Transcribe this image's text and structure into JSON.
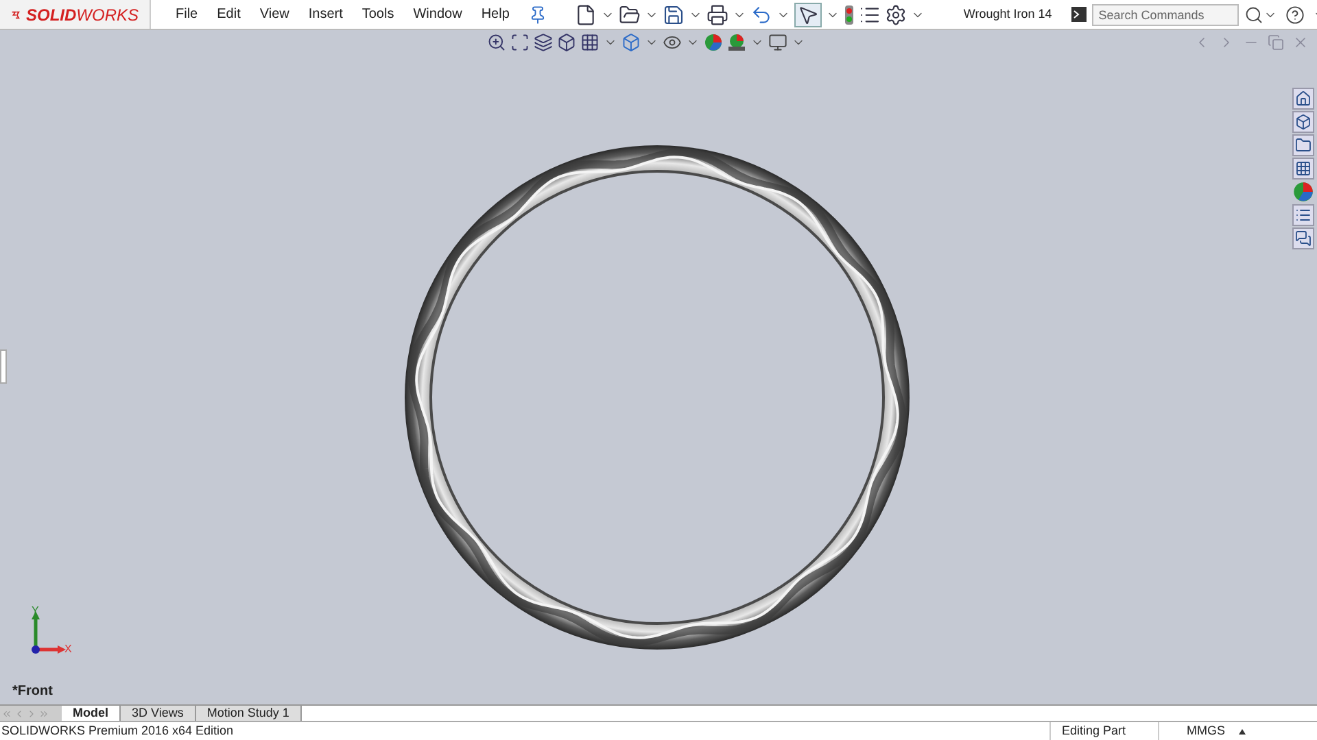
{
  "app": {
    "logo_prefix": "SOLID",
    "logo_suffix": "WORKS"
  },
  "menu": [
    {
      "label": "File"
    },
    {
      "label": "Edit"
    },
    {
      "label": "View"
    },
    {
      "label": "Insert"
    },
    {
      "label": "Tools"
    },
    {
      "label": "Window"
    },
    {
      "label": "Help"
    }
  ],
  "window": {
    "title": "Wrought Iron 14"
  },
  "search": {
    "placeholder": "Search Commands"
  },
  "viewport": {
    "view_name": "*Front",
    "axis_x": "X",
    "axis_y": "Y"
  },
  "tabs": [
    {
      "label": "Model",
      "selected": true
    },
    {
      "label": "3D Views",
      "selected": false
    },
    {
      "label": "Motion Study 1",
      "selected": false
    }
  ],
  "status_bar": {
    "product": "SOLIDWORKS Premium 2016 x64 Edition",
    "mode": "Editing Part",
    "units": "MMGS"
  }
}
